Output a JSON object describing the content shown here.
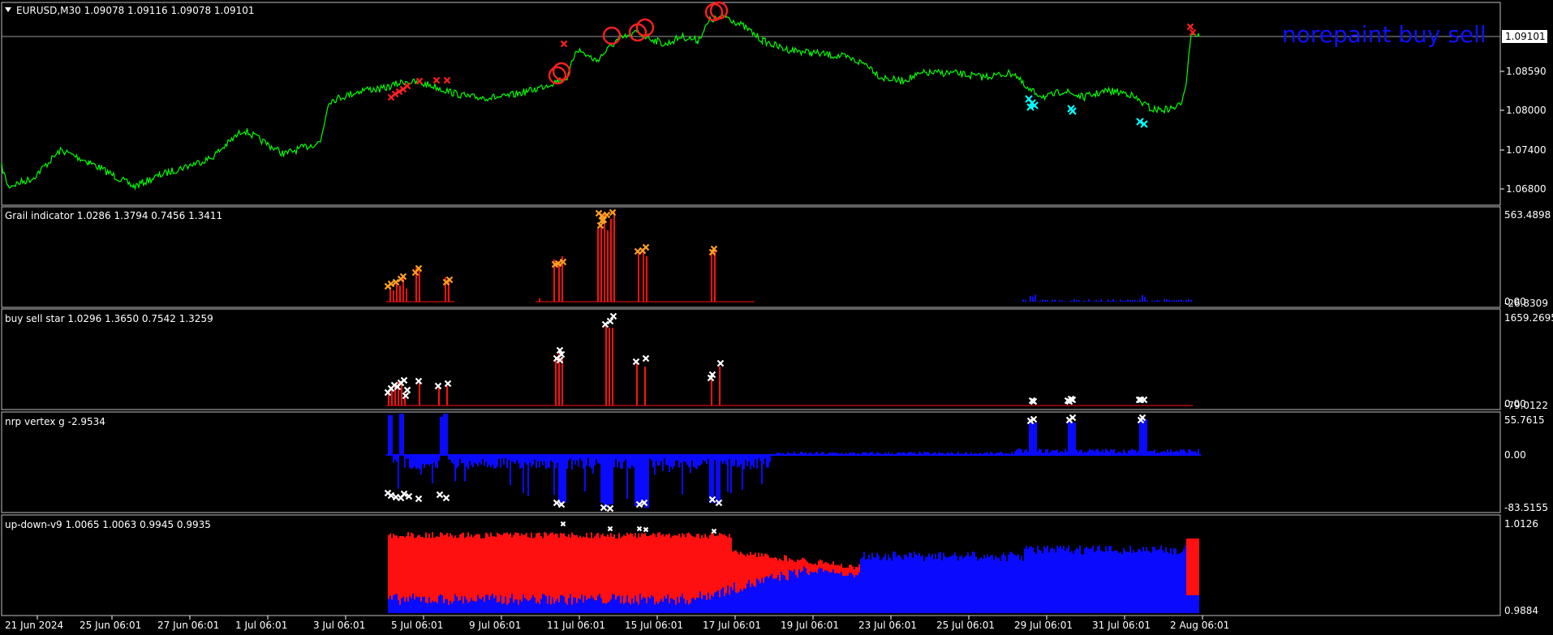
{
  "main": {
    "symbol_label": "EURUSD,M30  1.09078 1.09116 1.09078 1.09101",
    "watermark": "norepaint buy sell",
    "current_price": "1.09101",
    "price_ticks": [
      "1.09101",
      "1.08590",
      "1.08000",
      "1.07400",
      "1.06800"
    ],
    "colors": {
      "price_line": "#00ff00",
      "sell_marker": "#ff2020",
      "buy_marker": "#00ffff",
      "circle": "#ff2020"
    }
  },
  "panels": [
    {
      "label": "Grail indicator 1.0286 1.3794 0.7456 1.3411",
      "ticks": [
        "563.4898",
        "-26.8309",
        "0.00"
      ]
    },
    {
      "label": "buy sell star 1.0296 1.3650 0.7542 1.3259",
      "ticks": [
        "1659.2695",
        "-79.0122",
        "0.00"
      ]
    },
    {
      "label": "nrp vertex g -2.9534",
      "ticks": [
        "55.7615",
        "0.00",
        "-83.5155"
      ]
    },
    {
      "label": "up-down-v9 1.0065 1.0063 0.9945 0.9935",
      "ticks": [
        "1.0126",
        "0.9884"
      ]
    }
  ],
  "time_axis": [
    "21 Jun 2024",
    "25 Jun 06:01",
    "27 Jun 06:01",
    "1 Jul 06:01",
    "3 Jul 06:01",
    "5 Jul 06:01",
    "9 Jul 06:01",
    "11 Jul 06:01",
    "15 Jul 06:01",
    "17 Jul 06:01",
    "19 Jul 06:01",
    "23 Jul 06:01",
    "25 Jul 06:01",
    "29 Jul 06:01",
    "31 Jul 06:01",
    "2 Aug 06:01"
  ]
}
